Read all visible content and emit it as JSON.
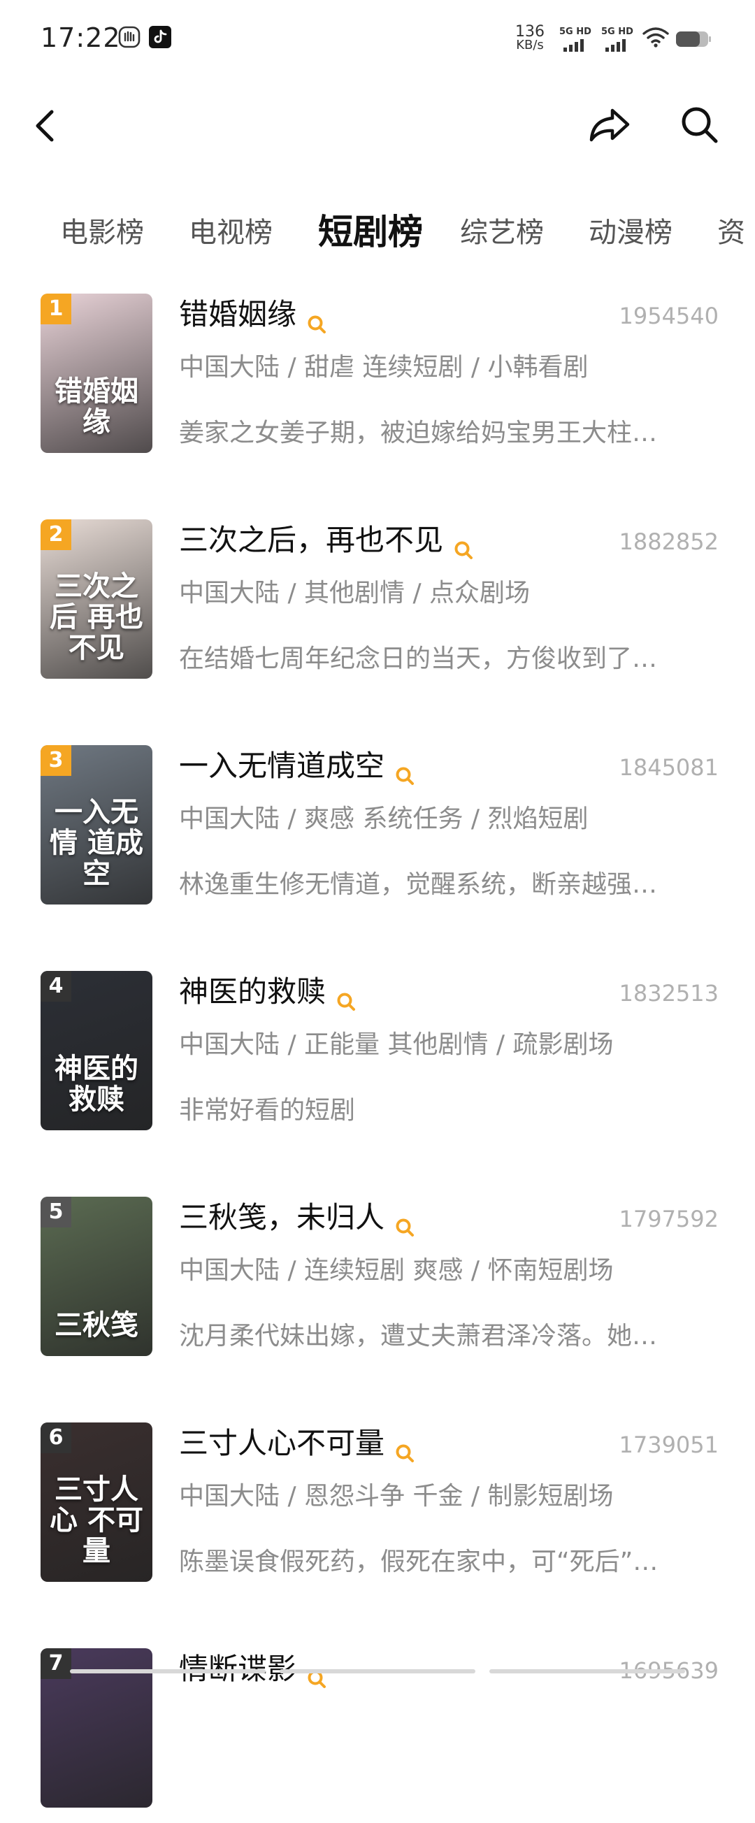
{
  "status": {
    "time": "17:22",
    "net_speed": "136",
    "net_unit": "KB/s",
    "sim1": "5G HD",
    "sim2": "5G HD",
    "icons": [
      "gesture-icon",
      "tiktok-icon",
      "wifi-icon",
      "battery-icon"
    ]
  },
  "header": {
    "back_icon": "chevron-left-icon",
    "share_icon": "share-icon",
    "search_icon": "search-icon"
  },
  "tabs": [
    {
      "label": "电影榜",
      "active": false
    },
    {
      "label": "电视榜",
      "active": false
    },
    {
      "label": "短剧榜",
      "active": true
    },
    {
      "label": "综艺榜",
      "active": false
    },
    {
      "label": "动漫榜",
      "active": false
    },
    {
      "label": "资",
      "active": false
    }
  ],
  "rank_color": "#f5a623",
  "items": [
    {
      "rank": "1",
      "title": "错婚姻缘",
      "score": "1954540",
      "meta": "中国大陆 / 甜虐 连续短剧 / 小韩看剧",
      "desc": "姜家之女姜子期，被迫嫁给妈宝男王大柱…",
      "poster_text": "错婚姻缘",
      "poster_color": "#e9d3d8",
      "rank_color": "#f5a623"
    },
    {
      "rank": "2",
      "title": "三次之后，再也不见",
      "score": "1882852",
      "meta": "中国大陆 / 其他剧情 / 点众剧场",
      "desc": "在结婚七周年纪念日的当天，方俊收到了…",
      "poster_text": "三次之后 再也不见",
      "poster_color": "#e8dcd6",
      "rank_color": "#f5a623"
    },
    {
      "rank": "3",
      "title": "一入无情道成空",
      "score": "1845081",
      "meta": "中国大陆 / 爽感 系统任务 / 烈焰短剧",
      "desc": "林逸重生修无情道，觉醒系统，断亲越强…",
      "poster_text": "一入无情 道成空",
      "poster_color": "#6f7882",
      "rank_color": "#f5a623"
    },
    {
      "rank": "4",
      "title": "神医的救赎",
      "score": "1832513",
      "meta": "中国大陆 / 正能量 其他剧情 / 疏影剧场",
      "desc": "非常好看的短剧",
      "poster_text": "神医的救赎",
      "poster_color": "#2c2f36",
      "rank_color": "#333333"
    },
    {
      "rank": "5",
      "title": "三秋笺，未归人",
      "score": "1797592",
      "meta": "中国大陆 / 连续短剧 爽感 / 怀南短剧场",
      "desc": "沈月柔代妹出嫁，遭丈夫萧君泽冷落。她…",
      "poster_text": "三秋笺",
      "poster_color": "#5b6b52",
      "rank_color": "#555555"
    },
    {
      "rank": "6",
      "title": "三寸人心不可量",
      "score": "1739051",
      "meta": "中国大陆 / 恩怨斗争 千金 / 制影短剧场",
      "desc": "陈墨误食假死药，假死在家中，可“死后”…",
      "poster_text": "三寸人心 不可量",
      "poster_color": "#3a2f2f",
      "rank_color": "#333333"
    },
    {
      "rank": "7",
      "title": "情断谍影",
      "score": "1695639",
      "meta": "",
      "desc": "",
      "poster_text": "",
      "poster_color": "#4a3a5c",
      "rank_color": "#333333"
    }
  ]
}
